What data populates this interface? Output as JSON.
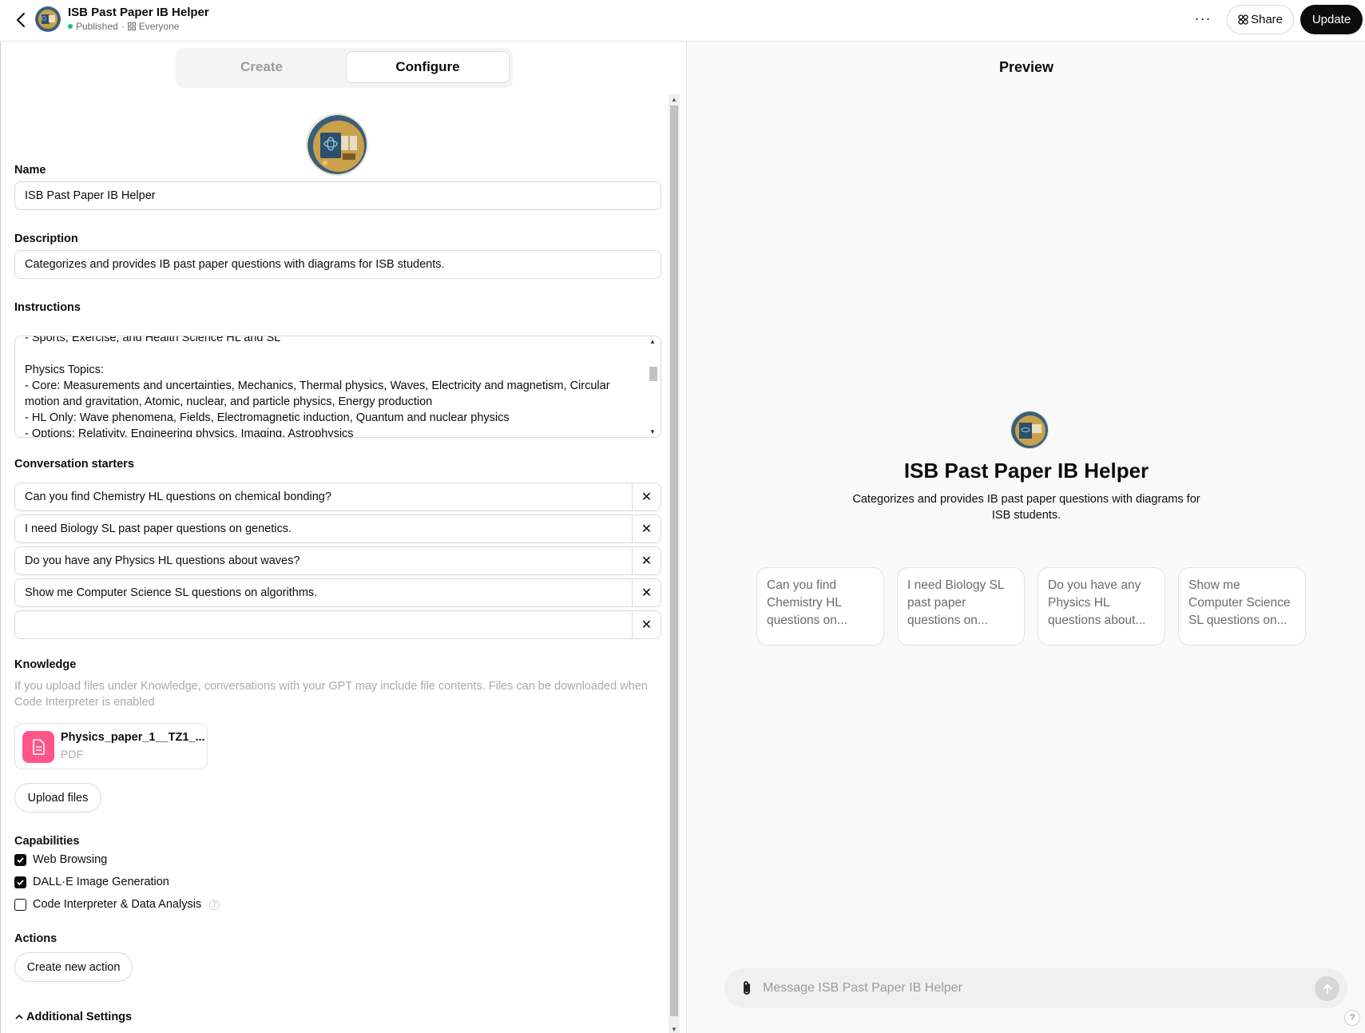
{
  "topbar": {
    "title": "ISB Past Paper IB Helper",
    "status": "Published",
    "separator": "·",
    "visibility": "Everyone",
    "more_label": "···",
    "share_label": "Share",
    "update_label": "Update"
  },
  "tabs": [
    {
      "label": "Create",
      "active": false
    },
    {
      "label": "Configure",
      "active": true
    }
  ],
  "form": {
    "name_label": "Name",
    "name_value": "ISB Past Paper IB Helper",
    "description_label": "Description",
    "description_value": "Categorizes and provides IB past paper questions with diagrams for ISB students.",
    "instructions_label": "Instructions",
    "instructions_value": "- Sports, Exercise, and Health Science HL and SL\n\nPhysics Topics:\n- Core: Measurements and uncertainties, Mechanics, Thermal physics, Waves, Electricity and magnetism, Circular motion and gravitation, Atomic, nuclear, and particle physics, Energy production\n- HL Only: Wave phenomena, Fields, Electromagnetic induction, Quantum and nuclear physics\n- Options: Relativity, Engineering physics, Imaging, Astrophysics",
    "starters_label": "Conversation starters",
    "starters": [
      "Can you find Chemistry HL questions on chemical bonding?",
      "I need Biology SL past paper questions on genetics.",
      "Do you have any Physics HL questions about waves?",
      "Show me Computer Science SL questions on algorithms.",
      ""
    ],
    "remove_glyph": "✕",
    "knowledge_label": "Knowledge",
    "knowledge_hint": "If you upload files under Knowledge, conversations with your GPT may include file contents. Files can be downloaded when Code Interpreter is enabled",
    "file": {
      "name": "Physics_paper_1__TZ1_...",
      "type": "PDF"
    },
    "upload_label": "Upload files",
    "capabilities_label": "Capabilities",
    "capabilities": [
      {
        "label": "Web Browsing",
        "checked": true
      },
      {
        "label": "DALL·E Image Generation",
        "checked": true
      },
      {
        "label": "Code Interpreter & Data Analysis",
        "checked": false
      }
    ],
    "help_glyph": "?",
    "actions_label": "Actions",
    "create_action_label": "Create new action",
    "additional_label": "Additional Settings"
  },
  "preview": {
    "title": "Preview",
    "gpt_name": "ISB Past Paper IB Helper",
    "gpt_description": "Categorizes and provides IB past paper questions with diagrams for ISB students.",
    "cards": [
      "Can you find Chemistry HL questions on...",
      "I need Biology SL past paper questions on...",
      "Do you have any Physics HL questions about...",
      "Show me Computer Science SL questions on..."
    ],
    "composer_placeholder": "Message ISB Past Paper IB Helper",
    "help_glyph": "?"
  },
  "icons": {
    "back": "chevron-left-icon",
    "share": "grid-icon",
    "attach": "paperclip-icon",
    "send": "arrow-up-icon",
    "file": "document-icon",
    "expand": "chevron-up-icon"
  },
  "colors": {
    "accent_dark": "#0d0d0d",
    "published_green": "#19c37d",
    "file_icon_bg": "#ff5588",
    "preview_bg": "#f9f9f9"
  }
}
